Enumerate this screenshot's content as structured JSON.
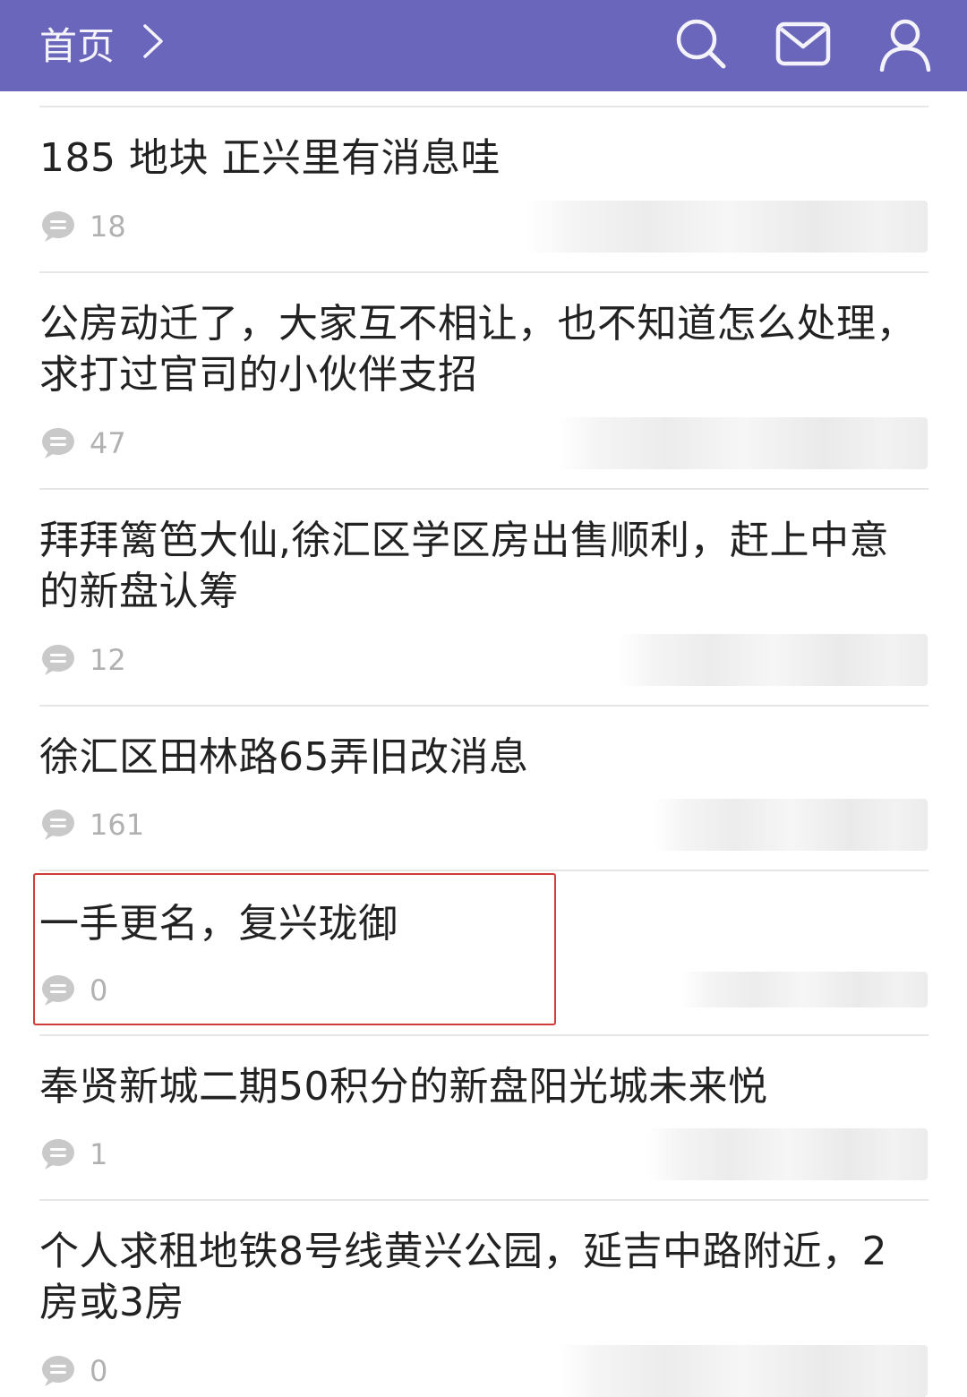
{
  "header": {
    "breadcrumb_label": "首页",
    "background_color": "#6a66bb",
    "icons": [
      "chevron-right-icon",
      "search-icon",
      "mail-icon",
      "user-icon"
    ]
  },
  "posts": [
    {
      "title": "185 地块 正兴里有消息哇",
      "comments": "18"
    },
    {
      "title": "公房动迁了，大家互不相让，也不知道怎么处理，求打过官司的小伙伴支招",
      "comments": "47"
    },
    {
      "title": "拜拜篱笆大仙,徐汇区学区房出售顺利，赶上中意的新盘认筹",
      "comments": "12"
    },
    {
      "title": "徐汇区田林路65弄旧改消息",
      "comments": "161"
    },
    {
      "title": "一手更名，复兴珑御",
      "comments": "0",
      "highlighted": true
    },
    {
      "title": "奉贤新城二期50积分的新盘阳光城未来悦",
      "comments": "1"
    },
    {
      "title": "个人求租地铁8号线黄兴公园，延吉中路附近，2房或3房",
      "comments": "0"
    }
  ],
  "highlight_color": "#d33b3b"
}
